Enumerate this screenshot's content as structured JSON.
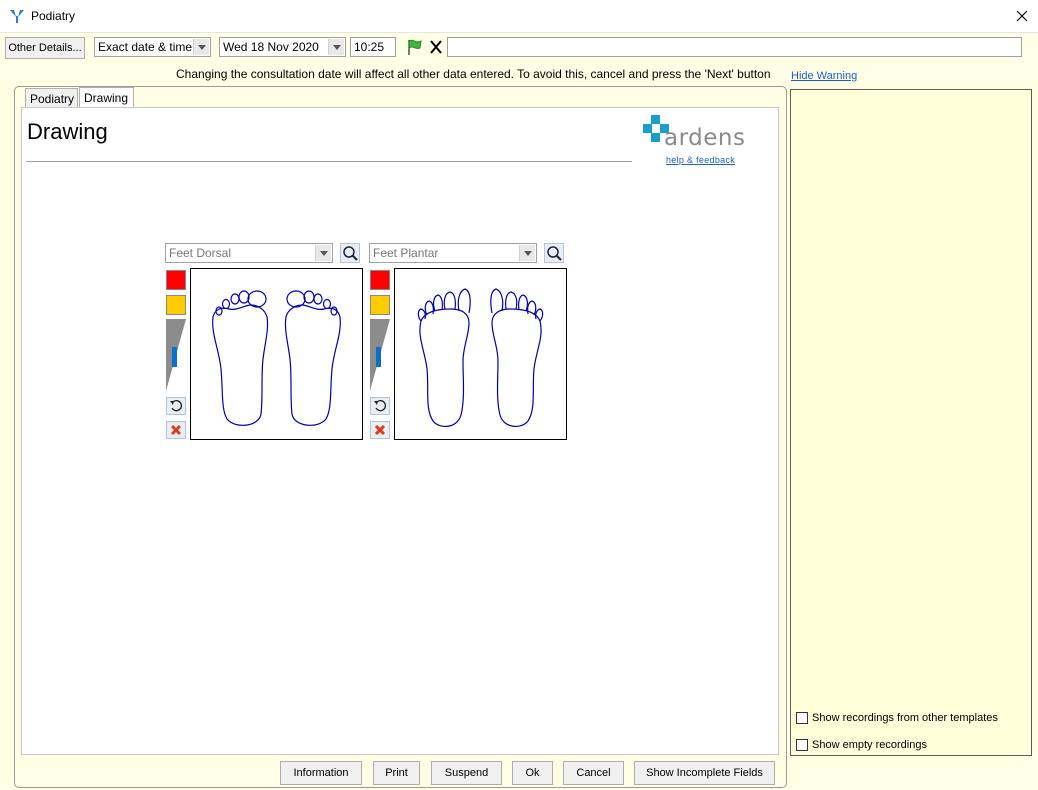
{
  "window": {
    "title": "Podiatry"
  },
  "toolbar": {
    "other_details_label": "Other Details...",
    "date_mode": "Exact date & time",
    "date_value": "Wed 18 Nov 2020",
    "time_value": "10:25",
    "free_text_value": ""
  },
  "warning": {
    "message": "Changing the consultation date will affect all other data entered. To avoid this, cancel and press the 'Next' button",
    "hide_label": "Hide Warning"
  },
  "tabs": [
    {
      "label": "Podiatry"
    },
    {
      "label": "Drawing"
    }
  ],
  "active_tab": "Drawing",
  "content": {
    "title": "Drawing",
    "brand": "ardens",
    "help_link": "help & feedback"
  },
  "drawings": [
    {
      "view": "Feet Dorsal"
    },
    {
      "view": "Feet Plantar"
    }
  ],
  "palette_colors": {
    "red": "#ff0000",
    "amber": "#ffcc00",
    "pen": "#0a6fcf",
    "outline": "#0000b0",
    "brand": "#1aa0c8"
  },
  "side_panel": {
    "show_other_templates_label": "Show recordings from other templates",
    "show_empty_label": "Show empty recordings"
  },
  "buttons": {
    "information": "Information",
    "print": "Print",
    "suspend": "Suspend",
    "ok": "Ok",
    "cancel": "Cancel",
    "show_incomplete": "Show Incomplete Fields"
  }
}
